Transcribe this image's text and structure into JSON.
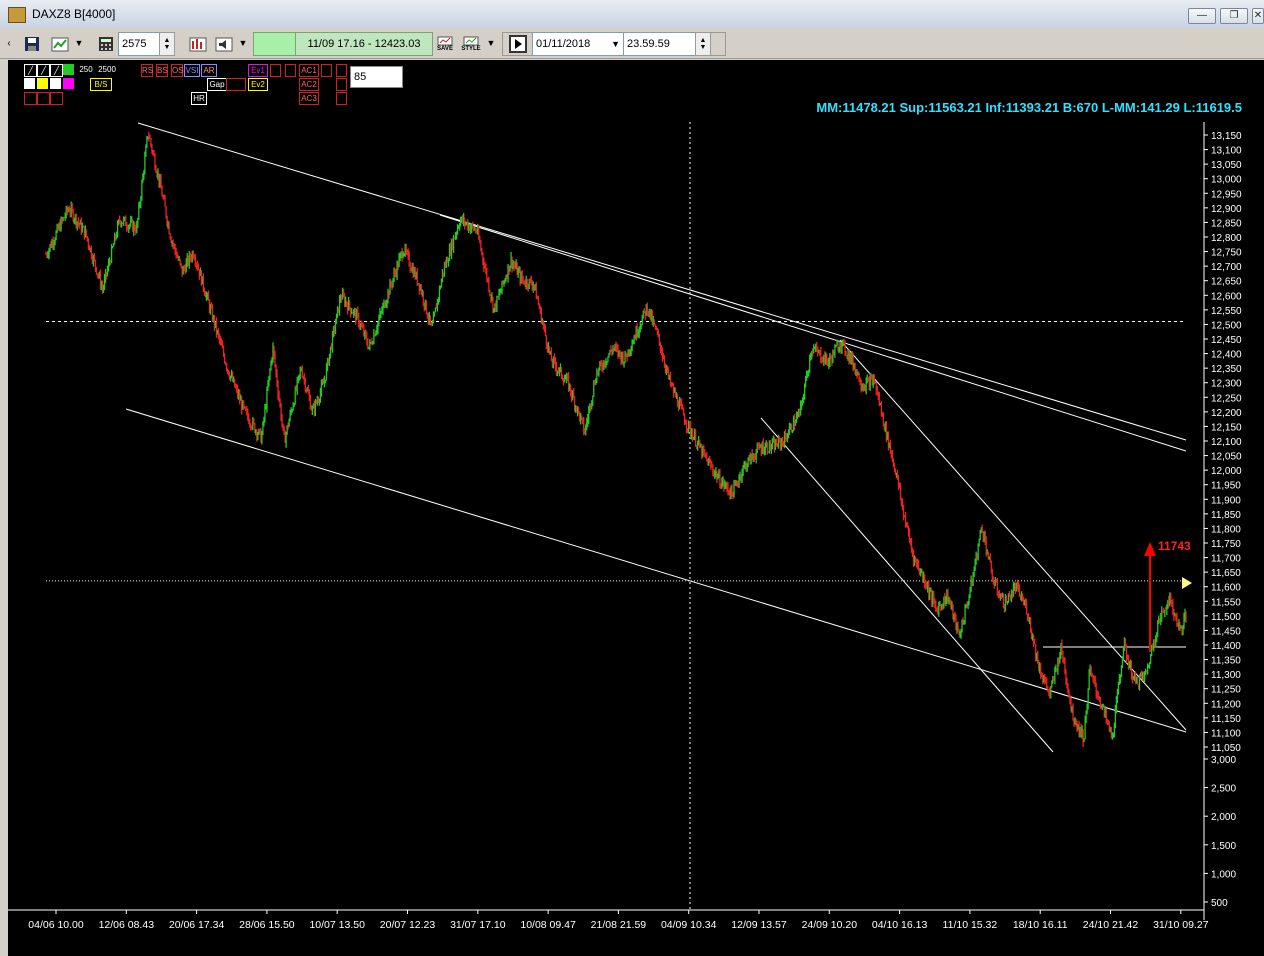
{
  "window": {
    "title": "DAXZ8 B[4000]",
    "minimize": "—",
    "restore": "❐",
    "close": "✕"
  },
  "toolbar": {
    "bars_value": "2575",
    "bar_info": "11/09 17.16 - 12423.03",
    "date_value": "01/11/2018",
    "time_value": "23.59.59",
    "save_label": "SAVE",
    "style_label": "STYLE"
  },
  "legend": {
    "period1": "250",
    "period2": "2500",
    "cells": [
      "B/S",
      "Gap",
      "VSI",
      "AR",
      "Ev1",
      "Ev2",
      "AC1",
      "AC2",
      "AC3",
      "HR",
      "RS",
      "BS",
      "OS"
    ],
    "input_value": "85"
  },
  "stats": "MM:11478.21 Sup:11563.21 Inf:11393.21 B:670 L-MM:141.29 L:11619.5",
  "annotation": {
    "target_label": "11743",
    "arrow_color": "#ff0000"
  },
  "colors": {
    "up": "#22cc22",
    "down": "#ee2222",
    "lines": "#ffffff",
    "stat": "#33e0ff",
    "background": "#000000"
  },
  "chart_data": {
    "type": "line",
    "instrument": "DAXZ8",
    "x_ticks": [
      "04/06 10.00",
      "12/06 08.43",
      "20/06 17.34",
      "28/06 15.50",
      "10/07 13.50",
      "20/07 12.23",
      "31/07 17.10",
      "10/08 09.47",
      "21/08 21.59",
      "04/09 10.34",
      "12/09 13.57",
      "24/09 10.20",
      "04/10 16.13",
      "11/10 15.32",
      "18/10 16.11",
      "24/10 21.42",
      "31/10 09.27"
    ],
    "y_ticks": [
      13150,
      13100,
      13050,
      13000,
      12950,
      12900,
      12850,
      12800,
      12750,
      12700,
      12650,
      12600,
      12550,
      12500,
      12450,
      12400,
      12350,
      12300,
      12250,
      12200,
      12150,
      12100,
      12050,
      12000,
      11950,
      11900,
      11850,
      11800,
      11750,
      11700,
      11650,
      11600,
      11550,
      11500,
      11450,
      11400,
      11350,
      11300,
      11250,
      11200,
      11150,
      11100,
      11050
    ],
    "y_tick_labels": [
      "13,150",
      "13,100",
      "13,050",
      "13,000",
      "12,950",
      "12,900",
      "12,850",
      "12,800",
      "12,750",
      "12,700",
      "12,650",
      "12,600",
      "12,550",
      "12,500",
      "12,450",
      "12,400",
      "12,350",
      "12,300",
      "12,250",
      "12,200",
      "12,150",
      "12,100",
      "12,050",
      "12,000",
      "11,950",
      "11,900",
      "11,850",
      "11,800",
      "11,750",
      "11,700",
      "11,650",
      "11,600",
      "11,550",
      "11,500",
      "11,450",
      "11,400",
      "11,350",
      "11,300",
      "11,250",
      "11,200",
      "11,150",
      "11,100",
      "11,050"
    ],
    "volume_ticks": [
      3000,
      2500,
      2000,
      1500,
      1000,
      500
    ],
    "volume_tick_labels": [
      "3,000",
      "2,500",
      "2,000",
      "1,500",
      "1,000",
      "500"
    ],
    "ylim": [
      11030,
      13180
    ],
    "price_path": [
      [
        0,
        12740
      ],
      [
        4,
        12900
      ],
      [
        7,
        12810
      ],
      [
        10,
        12620
      ],
      [
        13,
        12860
      ],
      [
        16,
        12830
      ],
      [
        18,
        13160
      ],
      [
        20,
        12990
      ],
      [
        22,
        12800
      ],
      [
        24,
        12680
      ],
      [
        26,
        12750
      ],
      [
        29,
        12550
      ],
      [
        32,
        12350
      ],
      [
        35,
        12200
      ],
      [
        38,
        12110
      ],
      [
        40,
        12420
      ],
      [
        42,
        12100
      ],
      [
        45,
        12350
      ],
      [
        47,
        12200
      ],
      [
        49,
        12300
      ],
      [
        52,
        12600
      ],
      [
        55,
        12520
      ],
      [
        57,
        12420
      ],
      [
        60,
        12590
      ],
      [
        63,
        12760
      ],
      [
        66,
        12630
      ],
      [
        68,
        12480
      ],
      [
        70,
        12680
      ],
      [
        73,
        12860
      ],
      [
        76,
        12820
      ],
      [
        79,
        12550
      ],
      [
        82,
        12720
      ],
      [
        84,
        12650
      ],
      [
        86,
        12640
      ],
      [
        89,
        12380
      ],
      [
        92,
        12300
      ],
      [
        94,
        12190
      ],
      [
        95,
        12130
      ],
      [
        97,
        12330
      ],
      [
        100,
        12420
      ],
      [
        102,
        12380
      ],
      [
        104,
        12470
      ],
      [
        106,
        12560
      ],
      [
        108,
        12450
      ],
      [
        110,
        12300
      ],
      [
        113,
        12160
      ],
      [
        116,
        12050
      ],
      [
        119,
        11960
      ],
      [
        121,
        11920
      ],
      [
        123,
        12010
      ],
      [
        126,
        12080
      ],
      [
        128,
        12080
      ],
      [
        130,
        12100
      ],
      [
        133,
        12200
      ],
      [
        135,
        12420
      ],
      [
        138,
        12370
      ],
      [
        140,
        12440
      ],
      [
        142,
        12380
      ],
      [
        144,
        12290
      ],
      [
        146,
        12310
      ],
      [
        148,
        12140
      ],
      [
        150,
        11980
      ],
      [
        151,
        11870
      ],
      [
        153,
        11700
      ],
      [
        155,
        11620
      ],
      [
        157,
        11520
      ],
      [
        159,
        11570
      ],
      [
        161,
        11430
      ],
      [
        163,
        11590
      ],
      [
        165,
        11810
      ],
      [
        167,
        11620
      ],
      [
        169,
        11540
      ],
      [
        171,
        11600
      ],
      [
        173,
        11520
      ],
      [
        175,
        11330
      ],
      [
        177,
        11230
      ],
      [
        179,
        11390
      ],
      [
        181,
        11160
      ],
      [
        183,
        11080
      ],
      [
        184,
        11310
      ],
      [
        186,
        11200
      ],
      [
        188,
        11080
      ],
      [
        190,
        11400
      ],
      [
        192,
        11270
      ],
      [
        194,
        11300
      ],
      [
        196,
        11470
      ],
      [
        198,
        11560
      ],
      [
        200,
        11450
      ],
      [
        201,
        11500
      ]
    ],
    "hlines": [
      {
        "value": 12510,
        "style": "dashed"
      },
      {
        "value": 11620,
        "style": "dotted"
      },
      {
        "value": 11393,
        "style": "solid"
      }
    ],
    "vline_at_tick": "04/09 10.34"
  }
}
